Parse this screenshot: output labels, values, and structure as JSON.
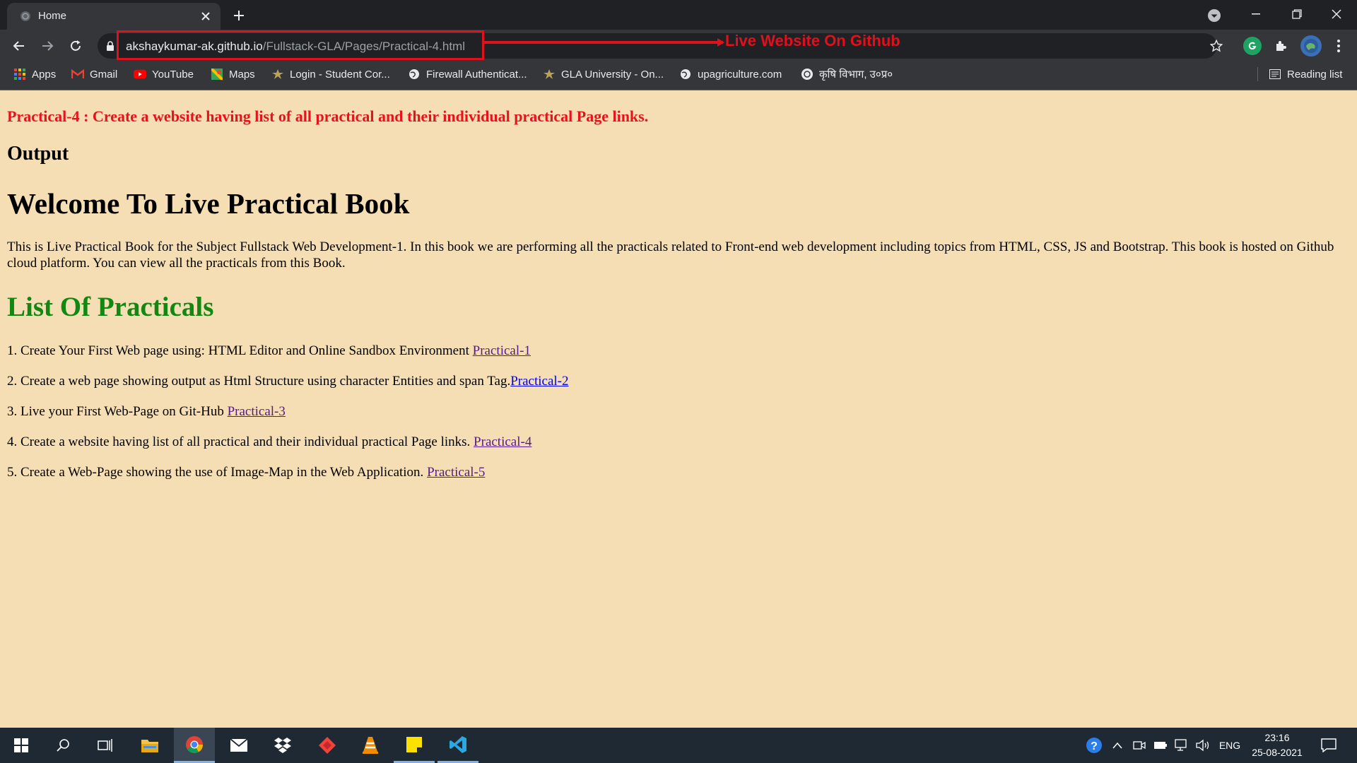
{
  "browser": {
    "tab_title": "Home",
    "url_host": "akshaykumar-ak.github.io",
    "url_path": "/Fullstack-GLA/Pages/Practical-4.html",
    "annotation": "Live Website On Github",
    "bookmarks": [
      "Apps",
      "Gmail",
      "YouTube",
      "Maps",
      "Login - Student Cor...",
      "Firewall Authenticat...",
      "GLA University - On...",
      "upagriculture.com",
      "कृषि विभाग, उ०प्र०"
    ],
    "reading_list": "Reading list"
  },
  "page": {
    "practical_title": "Practical-4 : Create a website having list of all practical and their individual practical Page links.",
    "output_heading": "Output",
    "welcome_heading": "Welcome To Live Practical Book",
    "intro": "This is Live Practical Book for the Subject Fullstack Web Development-1. In this book we are performing all the practicals related to Front-end web development including topics from HTML, CSS, JS and Bootstrap. This book is hosted on Github cloud platform. You can view all the practicals from this Book.",
    "list_heading": "List Of Practicals",
    "practicals": [
      {
        "text": "1. Create Your First Web page using: HTML Editor and Online Sandbox Environment ",
        "link": "Practical-1"
      },
      {
        "text": "2. Create a web page showing output as Html Structure using character Entities and span Tag.",
        "link": "Practical-2"
      },
      {
        "text": "3. Live your First Web-Page on Git-Hub ",
        "link": "Practical-3"
      },
      {
        "text": "4. Create a website having list of all practical and their individual practical Page links. ",
        "link": "Practical-4"
      },
      {
        "text": "5. Create a Web-Page showing the use of Image-Map in the Web Application. ",
        "link": "Practical-5"
      }
    ]
  },
  "taskbar": {
    "language": "ENG",
    "time": "23:16",
    "date": "25-08-2021"
  }
}
